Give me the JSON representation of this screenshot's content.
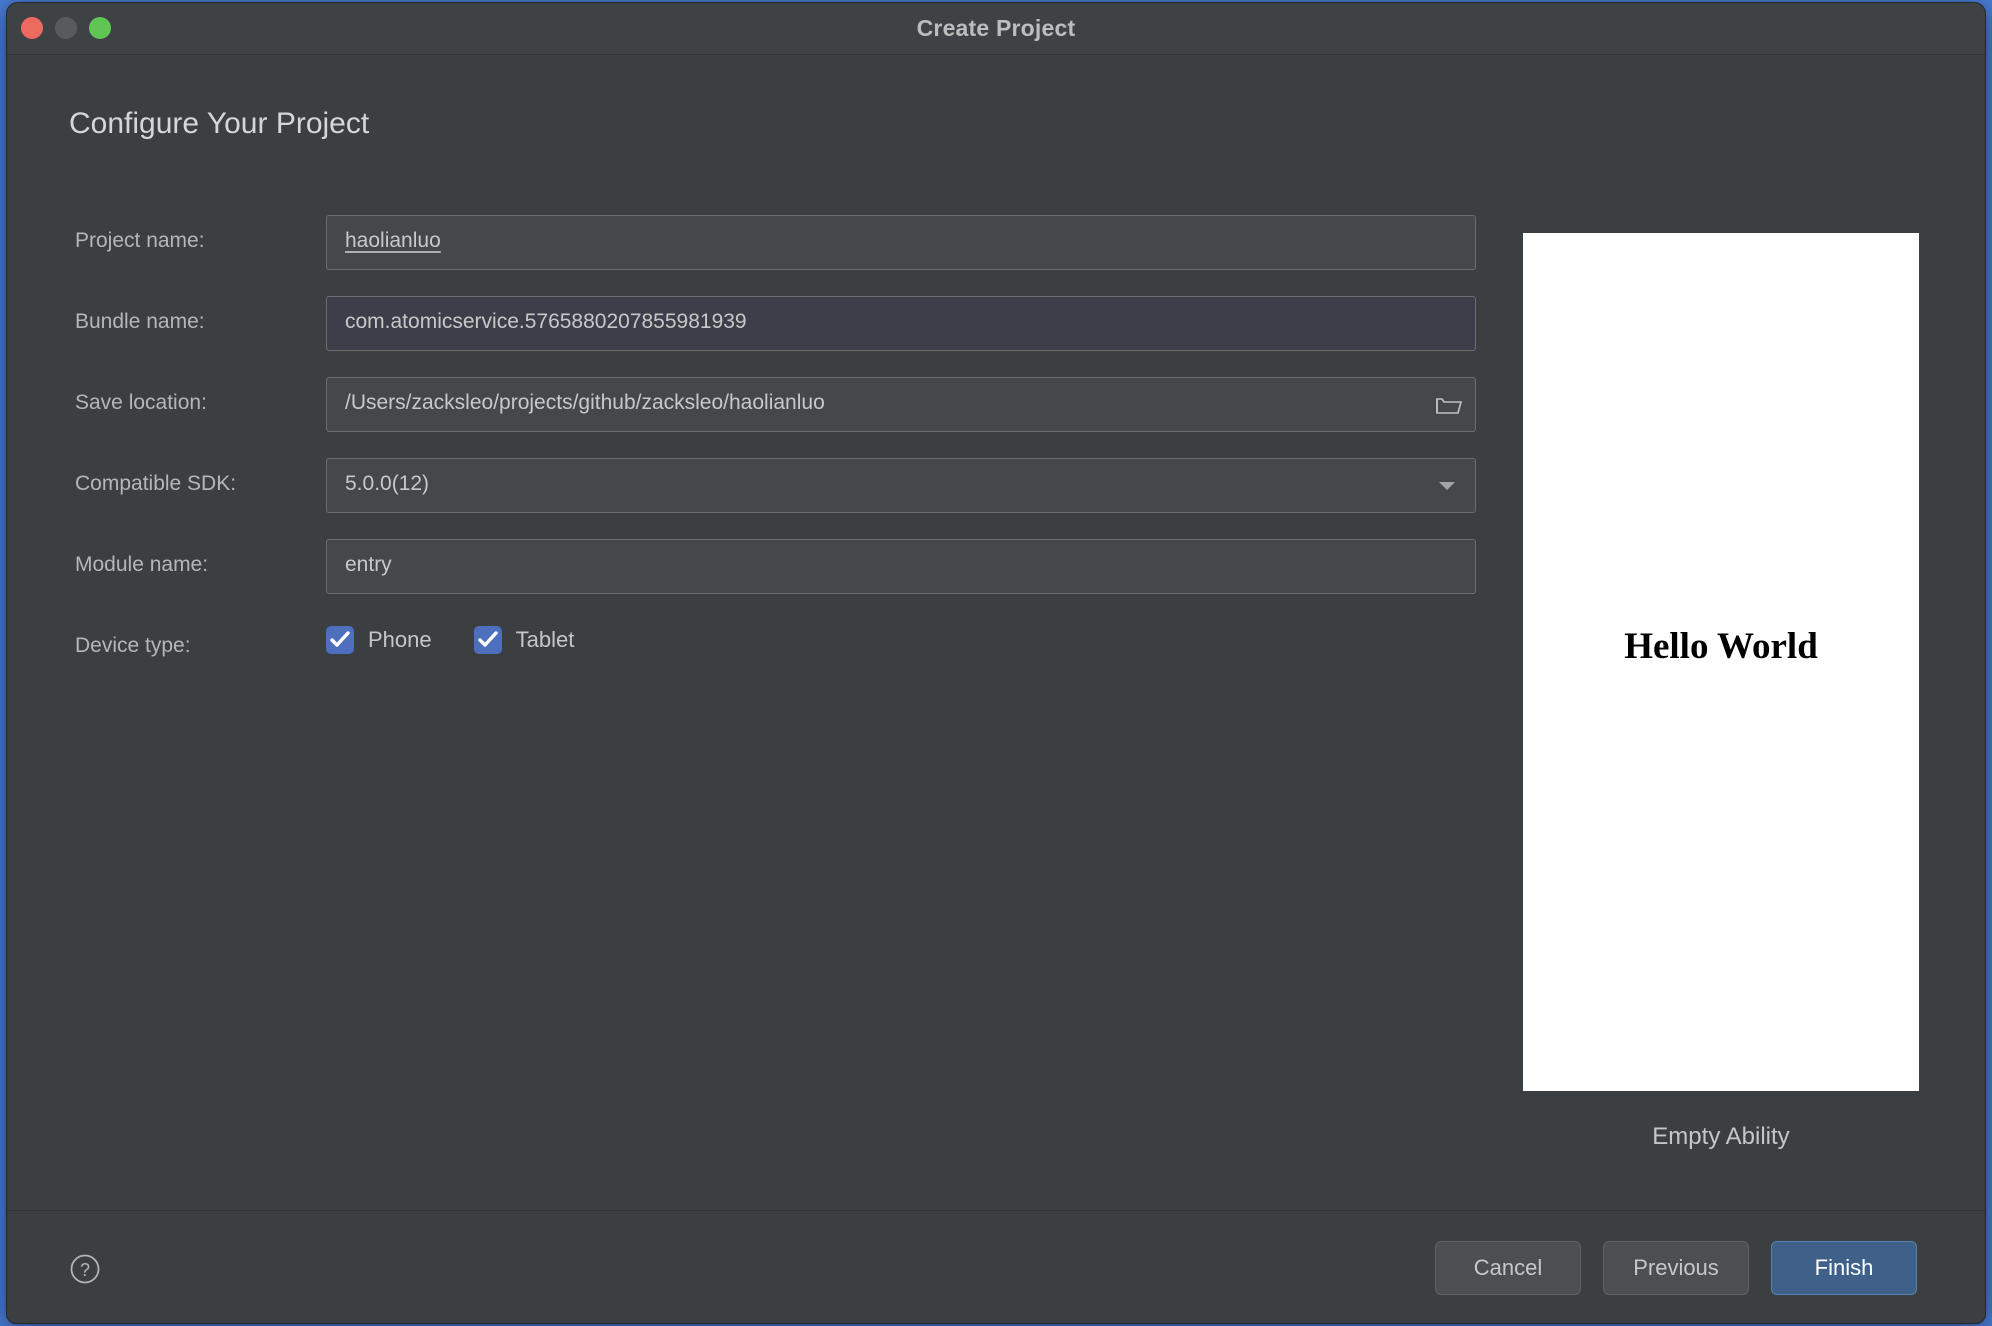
{
  "window": {
    "title": "Create Project",
    "controls": [
      {
        "name": "close",
        "color": "#ec6a5e"
      },
      {
        "name": "minimize",
        "color": "#585a5c"
      },
      {
        "name": "maximize",
        "color": "#61c555"
      }
    ]
  },
  "page": {
    "heading": "Configure Your Project"
  },
  "form": {
    "project_name": {
      "label": "Project name:",
      "value": "haolianluo",
      "placeholder": "Project name"
    },
    "bundle_name": {
      "label": "Bundle name:",
      "value": "com.atomicservice.5765880207855981939",
      "placeholder": "Bundle name"
    },
    "save_location": {
      "label": "Save location:",
      "value": "/Users/zacksleo/projects/github/zacksleo/haolianluo",
      "placeholder": "Save location",
      "browse_icon": "folder-open-icon"
    },
    "compatible_sdk": {
      "label": "Compatible SDK:",
      "value": "5.0.0(12)",
      "options": [
        "5.0.0(12)"
      ],
      "arrow_icon": "chevron-down-icon"
    },
    "module_name": {
      "label": "Module name:",
      "value": "entry",
      "placeholder": "Module name"
    },
    "device_type": {
      "label": "Device type:",
      "options": [
        {
          "label": "Phone",
          "checked": true
        },
        {
          "label": "Tablet",
          "checked": true
        }
      ]
    }
  },
  "preview": {
    "screen_text": "Hello World",
    "caption": "Empty Ability"
  },
  "footer": {
    "help_icon": "help-circle-icon",
    "cancel_label": "Cancel",
    "previous_label": "Previous",
    "finish_label": "Finish"
  },
  "colors": {
    "dialog_background": "#3c3f41",
    "titlebar": "#3f4244",
    "field_background": "#45484a",
    "field_background_readonly": "#3c3f4a",
    "checkbox_accent": "#4d6fbd",
    "primary_button": "#3f6088",
    "text": "#c8c8c8",
    "label_text": "#b6b6b6"
  }
}
